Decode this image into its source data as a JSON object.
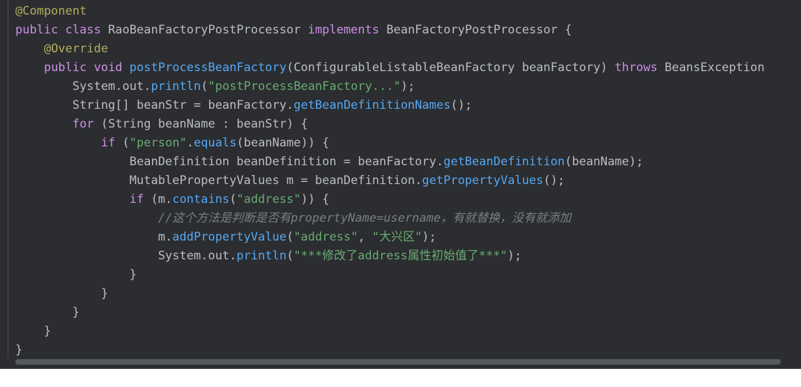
{
  "editor": {
    "language": "java",
    "colors": {
      "background": "#2b2d30",
      "text": "#bcbec4",
      "keyword": "#cf8ee8",
      "annotation": "#b3ae60",
      "method": "#56a8f5",
      "string": "#6aab73",
      "comment": "#7a7e85"
    },
    "horizontal_scrollbar": {
      "thumb_fraction": 1.0
    },
    "lines": [
      [
        {
          "t": "ann",
          "v": "@Component"
        }
      ],
      [
        {
          "t": "kw",
          "v": "public class "
        },
        {
          "t": "plain",
          "v": "RaoBeanFactoryPostProcessor "
        },
        {
          "t": "kw",
          "v": "implements "
        },
        {
          "t": "plain",
          "v": "BeanFactoryPostProcessor {"
        }
      ],
      [
        {
          "t": "plain",
          "v": "    "
        },
        {
          "t": "ann",
          "v": "@Override"
        }
      ],
      [
        {
          "t": "plain",
          "v": "    "
        },
        {
          "t": "kw",
          "v": "public void "
        },
        {
          "t": "fn",
          "v": "postProcessBeanFactory"
        },
        {
          "t": "plain",
          "v": "(ConfigurableListableBeanFactory beanFactory) "
        },
        {
          "t": "kw",
          "v": "throws "
        },
        {
          "t": "plain",
          "v": "BeansException"
        }
      ],
      [
        {
          "t": "plain",
          "v": "        System.out."
        },
        {
          "t": "fn",
          "v": "println"
        },
        {
          "t": "plain",
          "v": "("
        },
        {
          "t": "str",
          "v": "\"postProcessBeanFactory...\""
        },
        {
          "t": "plain",
          "v": ");"
        }
      ],
      [
        {
          "t": "plain",
          "v": "        String[] beanStr = beanFactory."
        },
        {
          "t": "fn",
          "v": "getBeanDefinitionNames"
        },
        {
          "t": "plain",
          "v": "();"
        }
      ],
      [
        {
          "t": "plain",
          "v": "        "
        },
        {
          "t": "kw",
          "v": "for "
        },
        {
          "t": "plain",
          "v": "(String beanName : beanStr) {"
        }
      ],
      [
        {
          "t": "plain",
          "v": "            "
        },
        {
          "t": "kw",
          "v": "if "
        },
        {
          "t": "plain",
          "v": "("
        },
        {
          "t": "str",
          "v": "\"person\""
        },
        {
          "t": "plain",
          "v": "."
        },
        {
          "t": "fn",
          "v": "equals"
        },
        {
          "t": "plain",
          "v": "(beanName)) {"
        }
      ],
      [
        {
          "t": "plain",
          "v": "                BeanDefinition beanDefinition = beanFactory."
        },
        {
          "t": "fn",
          "v": "getBeanDefinition"
        },
        {
          "t": "plain",
          "v": "(beanName);"
        }
      ],
      [
        {
          "t": "plain",
          "v": "                MutablePropertyValues m = beanDefinition."
        },
        {
          "t": "fn",
          "v": "getPropertyValues"
        },
        {
          "t": "plain",
          "v": "();"
        }
      ],
      [
        {
          "t": "plain",
          "v": "                "
        },
        {
          "t": "kw",
          "v": "if "
        },
        {
          "t": "plain",
          "v": "(m."
        },
        {
          "t": "fn",
          "v": "contains"
        },
        {
          "t": "plain",
          "v": "("
        },
        {
          "t": "str",
          "v": "\"address\""
        },
        {
          "t": "plain",
          "v": ")) {"
        }
      ],
      [
        {
          "t": "plain",
          "v": "                    "
        },
        {
          "t": "cm",
          "v": "//这个方法是判断是否有propertyName=username，有就替换，没有就添加"
        }
      ],
      [
        {
          "t": "plain",
          "v": "                    m."
        },
        {
          "t": "fn",
          "v": "addPropertyValue"
        },
        {
          "t": "plain",
          "v": "("
        },
        {
          "t": "str",
          "v": "\"address\""
        },
        {
          "t": "plain",
          "v": ", "
        },
        {
          "t": "str",
          "v": "\"大兴区\""
        },
        {
          "t": "plain",
          "v": ");"
        }
      ],
      [
        {
          "t": "plain",
          "v": "                    System.out."
        },
        {
          "t": "fn",
          "v": "println"
        },
        {
          "t": "plain",
          "v": "("
        },
        {
          "t": "str",
          "v": "\"***修改了address属性初始值了***\""
        },
        {
          "t": "plain",
          "v": ");"
        }
      ],
      [
        {
          "t": "plain",
          "v": "                }"
        }
      ],
      [
        {
          "t": "plain",
          "v": "            }"
        }
      ],
      [
        {
          "t": "plain",
          "v": "        }"
        }
      ],
      [
        {
          "t": "plain",
          "v": "    }"
        }
      ],
      [
        {
          "t": "plain",
          "v": "}"
        }
      ]
    ]
  }
}
